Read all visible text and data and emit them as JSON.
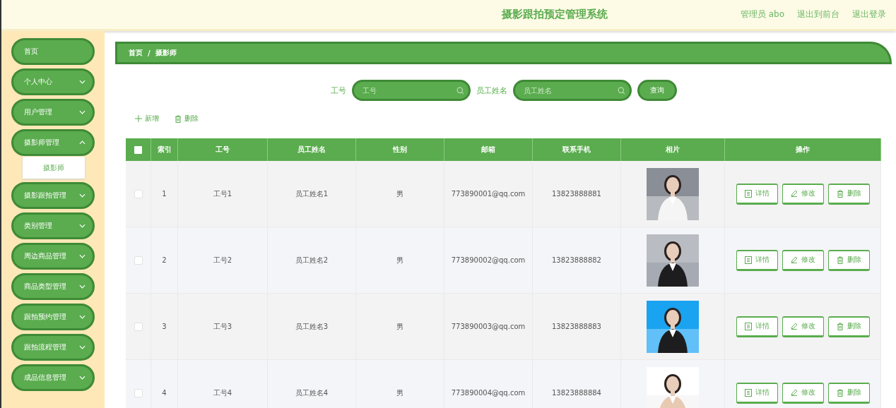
{
  "header": {
    "title": "摄影跟拍预定管理系统",
    "user": "管理员 abo",
    "links": [
      "退出到前台",
      "退出登录"
    ]
  },
  "sidebar": {
    "items": [
      {
        "kind": "link",
        "label": "首页"
      },
      {
        "kind": "menu",
        "label": "个人中心",
        "expanded": false
      },
      {
        "kind": "menu",
        "label": "用户管理",
        "expanded": false
      },
      {
        "kind": "menu",
        "label": "摄影师管理",
        "expanded": true,
        "children": [
          {
            "label": "摄影师"
          }
        ]
      },
      {
        "kind": "menu",
        "label": "摄影跟拍管理",
        "expanded": false
      },
      {
        "kind": "menu",
        "label": "类别管理",
        "expanded": false
      },
      {
        "kind": "menu",
        "label": "周边商品管理",
        "expanded": false
      },
      {
        "kind": "menu",
        "label": "商品类型管理",
        "expanded": false
      },
      {
        "kind": "menu",
        "label": "跟拍预约管理",
        "expanded": false
      },
      {
        "kind": "menu",
        "label": "跟拍流程管理",
        "expanded": false
      },
      {
        "kind": "menu",
        "label": "成品信息管理",
        "expanded": false
      }
    ]
  },
  "breadcrumb": {
    "separator": "/",
    "items": [
      "首页",
      "摄影师"
    ]
  },
  "search": {
    "fields": [
      {
        "label": "工号",
        "placeholder": "工号"
      },
      {
        "label": "员工姓名",
        "placeholder": "员工姓名"
      }
    ],
    "button": "查询"
  },
  "actions": [
    {
      "kind": "add",
      "label": "新增"
    },
    {
      "kind": "delete",
      "label": "删除"
    }
  ],
  "table": {
    "select_all": {
      "checked": false
    },
    "columns": [
      "索引",
      "工号",
      "员工姓名",
      "性别",
      "邮箱",
      "联系手机",
      "相片",
      "操作"
    ],
    "rows": [
      {
        "checked": false,
        "index": "1",
        "employee_no": "工号1",
        "name": "员工姓名1",
        "gender": "男",
        "email": "773890001@qq.com",
        "phone": "13823888881",
        "photo": {
          "kind": "picture"
        },
        "buttons": [
          {
            "kind": "detail",
            "label": "详情"
          },
          {
            "kind": "edit",
            "label": "修改"
          },
          {
            "kind": "delete",
            "label": "删除"
          }
        ]
      },
      {
        "checked": false,
        "index": "2",
        "employee_no": "工号2",
        "name": "员工姓名2",
        "gender": "男",
        "email": "773890002@qq.com",
        "phone": "13823888882",
        "photo": {
          "kind": "picture"
        },
        "buttons": [
          {
            "kind": "detail",
            "label": "详情"
          },
          {
            "kind": "edit",
            "label": "修改"
          },
          {
            "kind": "delete",
            "label": "删除"
          }
        ]
      },
      {
        "checked": false,
        "index": "3",
        "employee_no": "工号3",
        "name": "员工姓名3",
        "gender": "男",
        "email": "773890003@qq.com",
        "phone": "13823888883",
        "photo": {
          "kind": "picture"
        },
        "buttons": [
          {
            "kind": "detail",
            "label": "详情"
          },
          {
            "kind": "edit",
            "label": "修改"
          },
          {
            "kind": "delete",
            "label": "删除"
          }
        ]
      },
      {
        "checked": false,
        "index": "4",
        "employee_no": "工号4",
        "name": "员工姓名4",
        "gender": "男",
        "email": "773890004@qq.com",
        "phone": "13823888884",
        "photo": {
          "kind": "picture"
        },
        "buttons": [
          {
            "kind": "detail",
            "label": "详情"
          },
          {
            "kind": "edit",
            "label": "修改"
          },
          {
            "kind": "delete",
            "label": "删除"
          }
        ]
      }
    ]
  }
}
